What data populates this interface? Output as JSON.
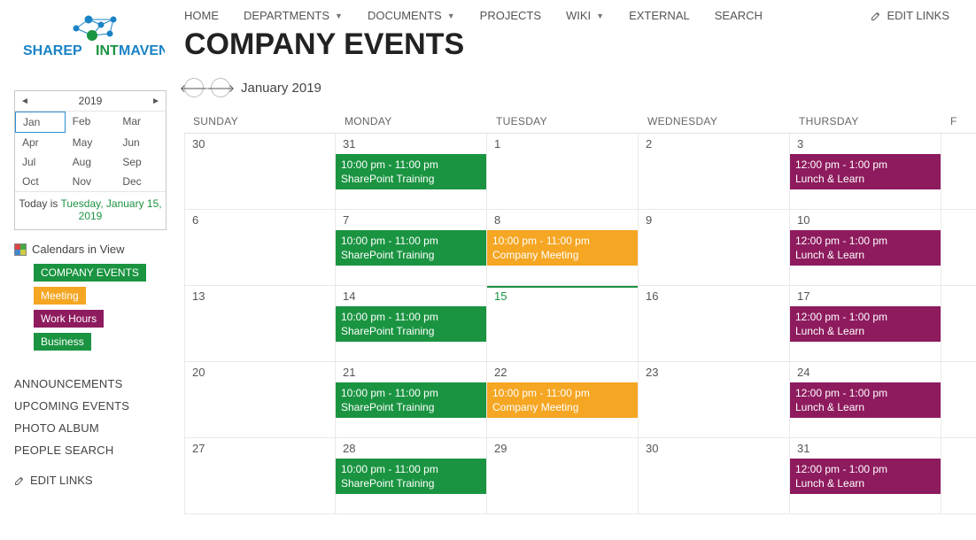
{
  "logo": {
    "brand_left": "SHAREP",
    "brand_right": "INTMAVEN"
  },
  "topnav": {
    "items": [
      {
        "label": "HOME",
        "dropdown": false
      },
      {
        "label": "DEPARTMENTS",
        "dropdown": true
      },
      {
        "label": "DOCUMENTS",
        "dropdown": true
      },
      {
        "label": "PROJECTS",
        "dropdown": false
      },
      {
        "label": "WIKI",
        "dropdown": true
      },
      {
        "label": "EXTERNAL",
        "dropdown": false
      },
      {
        "label": "SEARCH",
        "dropdown": false
      }
    ],
    "edit_links": "EDIT LINKS"
  },
  "page_title": "COMPANY EVENTS",
  "monthnav": {
    "label": "January 2019"
  },
  "yearpicker": {
    "year": "2019",
    "months": [
      "Jan",
      "Feb",
      "Mar",
      "Apr",
      "May",
      "Jun",
      "Jul",
      "Aug",
      "Sep",
      "Oct",
      "Nov",
      "Dec"
    ],
    "selected": "Jan",
    "today_prefix": "Today is ",
    "today_date": "Tuesday, January 15, 2019"
  },
  "civ": {
    "header": "Calendars in View",
    "items": [
      {
        "label": "COMPANY EVENTS",
        "class": "c-events"
      },
      {
        "label": "Meeting",
        "class": "c-meeting"
      },
      {
        "label": "Work Hours",
        "class": "c-work"
      },
      {
        "label": "Business",
        "class": "c-business"
      }
    ]
  },
  "leftnav": {
    "links": [
      "ANNOUNCEMENTS",
      "UPCOMING EVENTS",
      "PHOTO ALBUM",
      "PEOPLE SEARCH"
    ],
    "edit_links": "EDIT LINKS"
  },
  "dow": [
    "SUNDAY",
    "MONDAY",
    "TUESDAY",
    "WEDNESDAY",
    "THURSDAY",
    "F"
  ],
  "weeks": [
    [
      {
        "num": "30",
        "events": []
      },
      {
        "num": "31",
        "events": [
          {
            "time": "10:00 pm - 11:00 pm",
            "title": "SharePoint Training",
            "class": "ev-green"
          }
        ]
      },
      {
        "num": "1",
        "events": []
      },
      {
        "num": "2",
        "events": []
      },
      {
        "num": "3",
        "events": [
          {
            "time": "12:00 pm - 1:00 pm",
            "title": "Lunch & Learn",
            "class": "ev-purple"
          }
        ]
      },
      {
        "num": "",
        "events": []
      }
    ],
    [
      {
        "num": "6",
        "events": []
      },
      {
        "num": "7",
        "events": [
          {
            "time": "10:00 pm - 11:00 pm",
            "title": "SharePoint Training",
            "class": "ev-green"
          }
        ]
      },
      {
        "num": "8",
        "events": [
          {
            "time": "10:00 pm - 11:00 pm",
            "title": "Company Meeting",
            "class": "ev-orange"
          }
        ]
      },
      {
        "num": "9",
        "events": []
      },
      {
        "num": "10",
        "events": [
          {
            "time": "12:00 pm - 1:00 pm",
            "title": "Lunch & Learn",
            "class": "ev-purple"
          }
        ]
      },
      {
        "num": "",
        "events": []
      }
    ],
    [
      {
        "num": "13",
        "events": []
      },
      {
        "num": "14",
        "events": [
          {
            "time": "10:00 pm - 11:00 pm",
            "title": "SharePoint Training",
            "class": "ev-green"
          }
        ]
      },
      {
        "num": "15",
        "today": true,
        "events": []
      },
      {
        "num": "16",
        "events": []
      },
      {
        "num": "17",
        "events": [
          {
            "time": "12:00 pm - 1:00 pm",
            "title": "Lunch & Learn",
            "class": "ev-purple"
          }
        ]
      },
      {
        "num": "",
        "events": []
      }
    ],
    [
      {
        "num": "20",
        "events": []
      },
      {
        "num": "21",
        "events": [
          {
            "time": "10:00 pm - 11:00 pm",
            "title": "SharePoint Training",
            "class": "ev-green"
          }
        ]
      },
      {
        "num": "22",
        "events": [
          {
            "time": "10:00 pm - 11:00 pm",
            "title": "Company Meeting",
            "class": "ev-orange"
          }
        ]
      },
      {
        "num": "23",
        "events": []
      },
      {
        "num": "24",
        "events": [
          {
            "time": "12:00 pm - 1:00 pm",
            "title": "Lunch & Learn",
            "class": "ev-purple"
          }
        ]
      },
      {
        "num": "",
        "events": []
      }
    ],
    [
      {
        "num": "27",
        "events": []
      },
      {
        "num": "28",
        "events": [
          {
            "time": "10:00 pm - 11:00 pm",
            "title": "SharePoint Training",
            "class": "ev-green"
          }
        ]
      },
      {
        "num": "29",
        "events": []
      },
      {
        "num": "30",
        "events": []
      },
      {
        "num": "31",
        "events": [
          {
            "time": "12:00 pm - 1:00 pm",
            "title": "Lunch & Learn",
            "class": "ev-purple"
          }
        ]
      },
      {
        "num": "",
        "events": []
      }
    ]
  ]
}
